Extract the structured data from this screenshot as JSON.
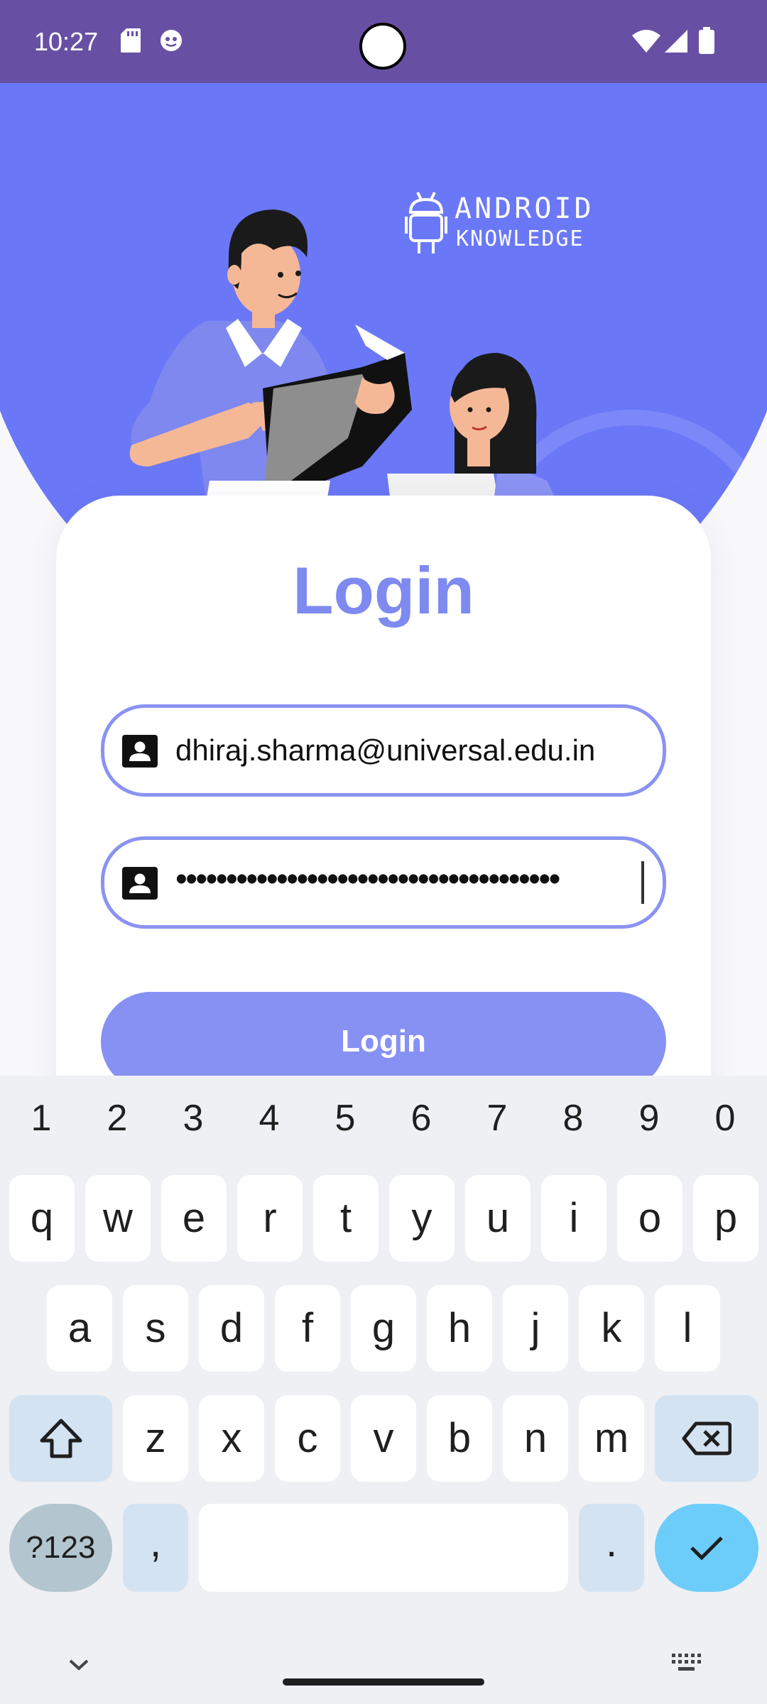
{
  "status_bar": {
    "time": "10:27"
  },
  "hero": {
    "logo_line1": "ANDROID",
    "logo_line2": "KNOWLEDGE"
  },
  "login_card": {
    "title": "Login",
    "email_value": "dhiraj.sharma@universal.edu.in",
    "password_masked": "••••••••••••••••••••••••••••••••••••••",
    "button_label": "Login"
  },
  "keyboard": {
    "number_row": [
      "1",
      "2",
      "3",
      "4",
      "5",
      "6",
      "7",
      "8",
      "9",
      "0"
    ],
    "row1": [
      "q",
      "w",
      "e",
      "r",
      "t",
      "y",
      "u",
      "i",
      "o",
      "p"
    ],
    "row2": [
      "a",
      "s",
      "d",
      "f",
      "g",
      "h",
      "j",
      "k",
      "l"
    ],
    "row3": [
      "z",
      "x",
      "c",
      "v",
      "b",
      "n",
      "m"
    ],
    "symbols_label": "?123",
    "comma_label": ",",
    "period_label": "."
  },
  "colors": {
    "status_bar": "#6750a4",
    "hero": "#6a78f7",
    "accent": "#7e8af0",
    "button": "#8790f3",
    "enter_key": "#6dcdfa"
  }
}
